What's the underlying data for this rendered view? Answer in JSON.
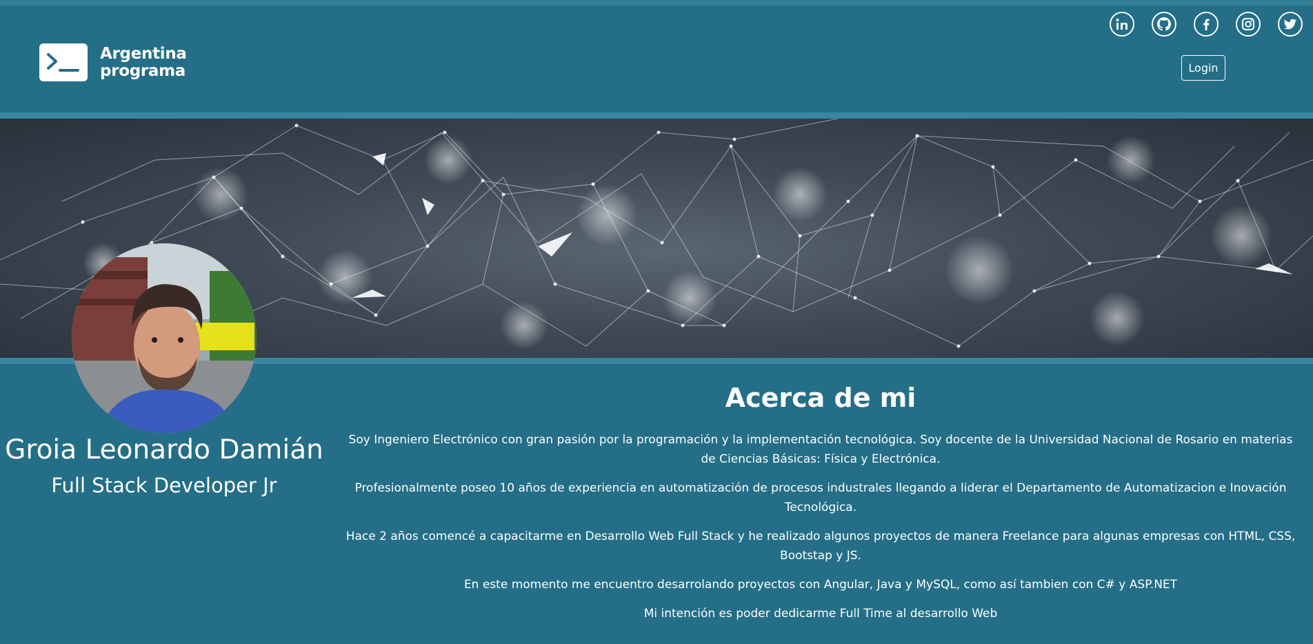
{
  "header": {
    "logo": {
      "line1": "Argentina",
      "line2": "programa",
      "icon": "terminal-icon"
    },
    "social": [
      {
        "name": "linkedin",
        "icon": "linkedin-icon"
      },
      {
        "name": "github",
        "icon": "github-icon"
      },
      {
        "name": "facebook",
        "icon": "facebook-icon"
      },
      {
        "name": "instagram",
        "icon": "instagram-icon"
      },
      {
        "name": "twitter",
        "icon": "twitter-icon"
      }
    ],
    "login_label": "Login"
  },
  "profile": {
    "name": "Groia Leonardo Damián",
    "title": "Full Stack Developer Jr"
  },
  "about": {
    "heading": "Acerca de mi",
    "paragraphs": [
      "Soy Ingeniero Electrónico con gran pasión por la programación y la implementación tecnológica. Soy docente de la Universidad Nacional de Rosario en materias de Ciencias Básicas: Física y Electrónica.",
      "Profesionalmente poseo 10 años de experiencia en automatización de procesos industrales llegando a liderar el Departamento de Automatizacion e Inovación Tecnológica.",
      "Hace 2 años comencé a capacitarme en Desarrollo Web Full Stack y he realizado algunos proyectos de manera Freelance para algunas empresas con HTML, CSS, Bootstap y JS.",
      "En este momento me encuentro desarrolando proyectos con Angular, Java y MySQL, como así tambien con C# y ASP.NET",
      "Mi intención es poder dedicarme Full Time al desarrollo Web"
    ]
  },
  "colors": {
    "background": "#246e87",
    "divider": "#3a86a0",
    "text": "#ffffff"
  }
}
